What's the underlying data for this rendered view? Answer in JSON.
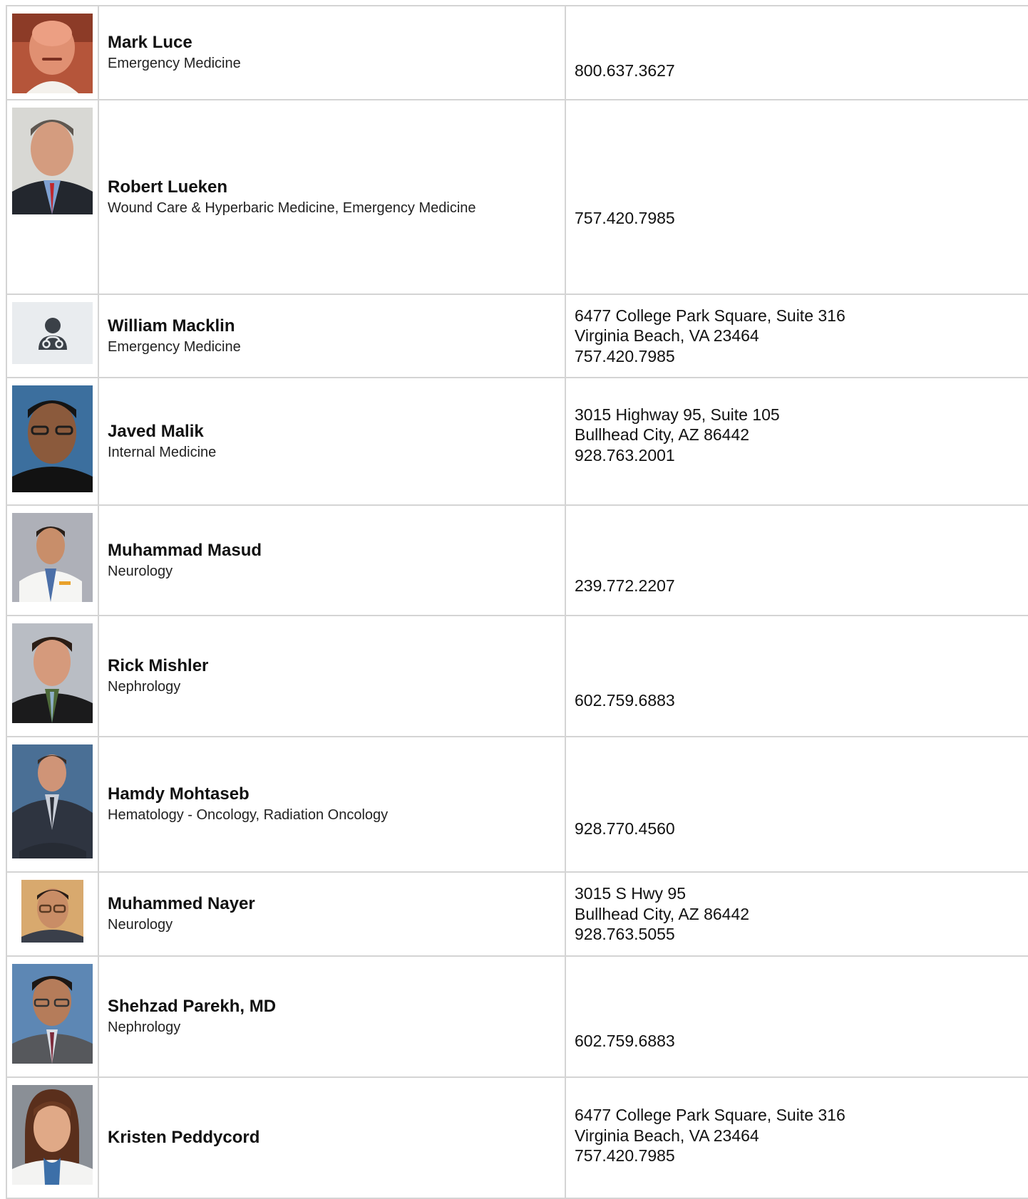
{
  "doctors": [
    {
      "name": "Mark Luce",
      "specialty": "Emergency Medicine",
      "address_line1": "",
      "address_line2": "",
      "phone": "800.637.3627",
      "photo": "photo-bald-man"
    },
    {
      "name": "Robert Lueken",
      "specialty": "Wound Care & Hyperbaric Medicine, Emergency Medicine",
      "address_line1": "",
      "address_line2": "",
      "phone": "757.420.7985",
      "photo": "photo-man-suit"
    },
    {
      "name": "William Macklin",
      "specialty": "Emergency Medicine",
      "address_line1": "6477 College Park Square, Suite 316",
      "address_line2": "Virginia Beach, VA 23464",
      "phone": "757.420.7985",
      "photo": "doctor-placeholder-icon"
    },
    {
      "name": "Javed Malik",
      "specialty": "Internal Medicine",
      "address_line1": "3015 Highway 95, Suite 105",
      "address_line2": "Bullhead City, AZ 86442",
      "phone": "928.763.2001",
      "photo": "photo-man-glasses"
    },
    {
      "name": "Muhammad Masud",
      "specialty": "Neurology",
      "address_line1": "",
      "address_line2": "",
      "phone": "239.772.2207",
      "photo": "photo-man-white-coat"
    },
    {
      "name": "Rick Mishler",
      "specialty": "Nephrology",
      "address_line1": "",
      "address_line2": "",
      "phone": "602.759.6883",
      "photo": "photo-man-suit"
    },
    {
      "name": "Hamdy Mohtaseb",
      "specialty": "Hematology - Oncology, Radiation Oncology",
      "address_line1": "",
      "address_line2": "",
      "phone": "928.770.4560",
      "photo": "photo-man-suit"
    },
    {
      "name": "Muhammed Nayer",
      "specialty": "Neurology",
      "address_line1": "3015 S Hwy 95",
      "address_line2": "Bullhead City, AZ 86442",
      "phone": "928.763.5055",
      "photo": "photo-man-glasses"
    },
    {
      "name": "Shehzad Parekh, MD",
      "specialty": "Nephrology",
      "address_line1": "",
      "address_line2": "",
      "phone": "602.759.6883",
      "photo": "photo-man-glasses"
    },
    {
      "name": "Kristen Peddycord",
      "specialty": "",
      "address_line1": "6477 College Park Square, Suite 316",
      "address_line2": "Virginia Beach, VA 23464",
      "phone": "757.420.7985",
      "photo": "photo-woman"
    }
  ]
}
